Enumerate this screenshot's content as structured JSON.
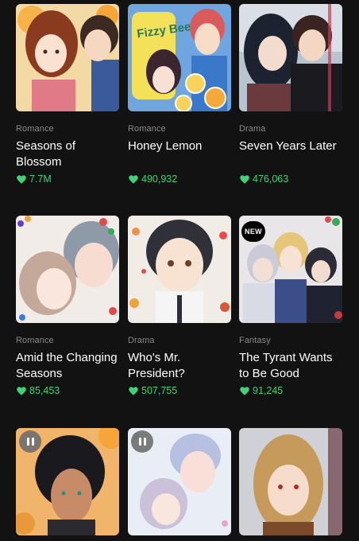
{
  "series": [
    {
      "genre": "Romance",
      "title": "Seasons of Blossom",
      "likes": "7.7M",
      "badge": ""
    },
    {
      "genre": "Romance",
      "title": "Honey Lemon",
      "likes": "490,932",
      "badge": ""
    },
    {
      "genre": "Drama",
      "title": "Seven Years Later",
      "likes": "476,063",
      "badge": ""
    },
    {
      "genre": "Romance",
      "title": "Amid the Changing Seasons",
      "likes": "85,453",
      "badge": ""
    },
    {
      "genre": "Drama",
      "title": "Who's Mr. President?",
      "likes": "507,755",
      "badge": ""
    },
    {
      "genre": "Fantasy",
      "title": "The Tyrant Wants to Be Good",
      "likes": "91,245",
      "badge": "NEW"
    }
  ],
  "cover_art_text": {
    "honey_lemon_can": "Fizzy Bee"
  },
  "colors": {
    "background": "#121212",
    "genre_text": "#8a8a8a",
    "title_text": "#ffffff",
    "likes_green": "#3fd277"
  },
  "icons": {
    "likes": "heart-icon",
    "paused": "pause-icon"
  }
}
